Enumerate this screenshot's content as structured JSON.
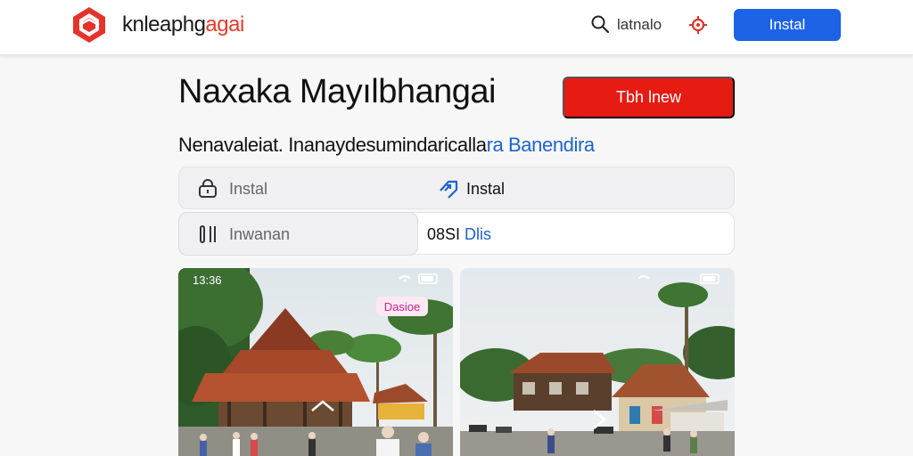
{
  "header": {
    "brand_main": "knleaphg",
    "brand_accent": "agai",
    "search_label": "latnalo",
    "install_label": "Instal",
    "icons": [
      "logo-icon",
      "search-icon",
      "gear-icon"
    ],
    "colors": {
      "install_bg": "#1c63e6",
      "logo": "#e5332a"
    }
  },
  "main": {
    "title": "Naxaka Mayılbhangai",
    "primary_button": "Tbh lnew",
    "subtitle_text": "Nenavaleiat. Inanaydesumindaricalla",
    "subtitle_link": "ra Banendira",
    "colors": {
      "primary_button_bg": "#e61b12",
      "link": "#1f63c9"
    }
  },
  "info_rows": [
    {
      "left_label": "Instal",
      "left_icon": "lock-icon",
      "right_label": "Instal",
      "right_icon": "share-icon"
    },
    {
      "left_label": "Inwanan",
      "left_icon": "storage-icon",
      "right_prefix": "08SI",
      "right_value": "Dlis"
    }
  ],
  "screenshots": [
    {
      "status_time": "13:36",
      "tag": "Dasioe",
      "scene": "traditional-pavilion-photo"
    },
    {
      "status_time": "",
      "tag": "",
      "scene": "village-houses-photo"
    }
  ]
}
